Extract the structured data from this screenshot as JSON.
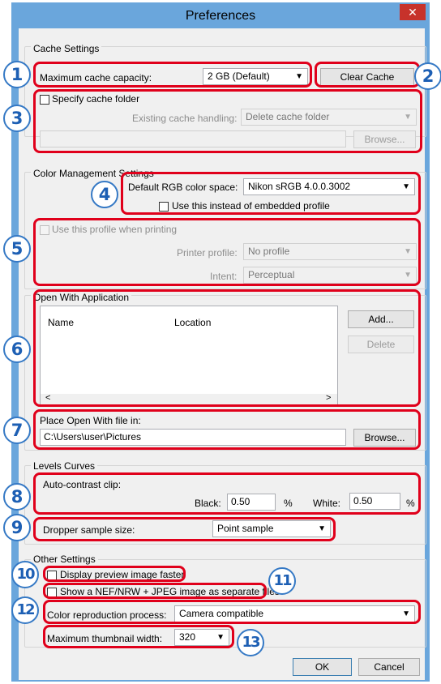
{
  "window": {
    "title": "Preferences",
    "close_glyph": "✕"
  },
  "cache": {
    "group_label": "Cache Settings",
    "max_capacity_label": "Maximum cache capacity:",
    "max_capacity_value": "2 GB (Default)",
    "clear_button": "Clear Cache",
    "specify_folder_label": "Specify cache folder",
    "existing_handling_label": "Existing cache handling:",
    "existing_handling_value": "Delete cache folder",
    "folder_path": "",
    "browse_button": "Browse..."
  },
  "color_mgmt": {
    "group_label": "Color Management Settings",
    "default_rgb_label": "Default RGB color space:",
    "default_rgb_value": "Nikon sRGB 4.0.0.3002",
    "use_instead_label": "Use this instead of embedded profile",
    "use_when_printing_label": "Use this profile when printing",
    "printer_profile_label": "Printer profile:",
    "printer_profile_value": "No profile",
    "intent_label": "Intent:",
    "intent_value": "Perceptual"
  },
  "open_with": {
    "group_label": "Open With Application",
    "columns": [
      "Name",
      "Location"
    ],
    "add_button": "Add...",
    "delete_button": "Delete",
    "place_label": "Place Open With file in:",
    "place_value": "C:\\Users\\user\\Pictures",
    "browse_button": "Browse..."
  },
  "levels": {
    "group_label": "Levels  Curves",
    "auto_contrast_label": "Auto-contrast clip:",
    "black_label": "Black:",
    "black_value": "0.50",
    "white_label": "White:",
    "white_value": "0.50",
    "percent": "%",
    "dropper_label": "Dropper sample size:",
    "dropper_value": "Point sample"
  },
  "other": {
    "group_label": "Other Settings",
    "display_preview_label": "Display preview image faster",
    "show_nef_label": "Show a NEF/NRW + JPEG image as separate files",
    "color_repro_label": "Color reproduction process:",
    "color_repro_value": "Camera compatible",
    "max_thumb_label": "Maximum thumbnail width:",
    "max_thumb_value": "320"
  },
  "footer": {
    "ok": "OK",
    "cancel": "Cancel"
  },
  "callouts": [
    "1",
    "2",
    "3",
    "4",
    "5",
    "6",
    "7",
    "8",
    "9",
    "10",
    "11",
    "12",
    "13"
  ],
  "colors": {
    "highlight": "#e0001b",
    "callout": "#1d5fb4",
    "titlebar": "#6aa6dc"
  }
}
